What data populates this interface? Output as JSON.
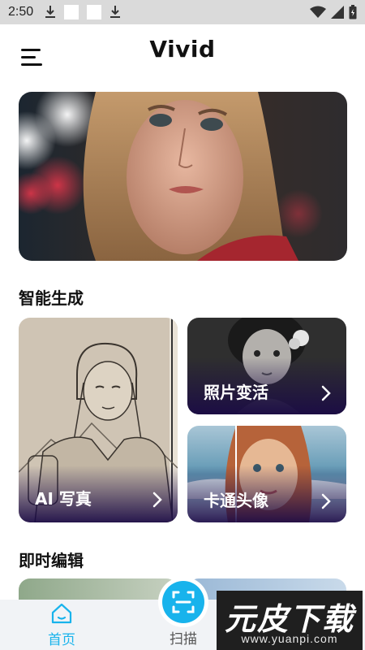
{
  "status_bar": {
    "time": "2:50",
    "left_icons": [
      "download-icon",
      "square-icon",
      "square-icon",
      "download-icon"
    ],
    "right_icons": [
      "wifi-icon",
      "signal-icon",
      "battery-icon"
    ]
  },
  "app_bar": {
    "title": "Vivid",
    "menu_icon": "menu-icon"
  },
  "sections": {
    "smart_generate": "智能生成",
    "instant_edit": "即时编辑"
  },
  "cards": {
    "ai_portrait": "AI 写真",
    "photo_transform": "照片变活",
    "cartoon_avatar": "卡通头像"
  },
  "bottom_nav": {
    "home": "首页",
    "scan": "扫描",
    "active_color": "#18b3ec"
  },
  "watermark": {
    "logo_text": "元皮下载",
    "url": "www.yuanpi.com"
  }
}
